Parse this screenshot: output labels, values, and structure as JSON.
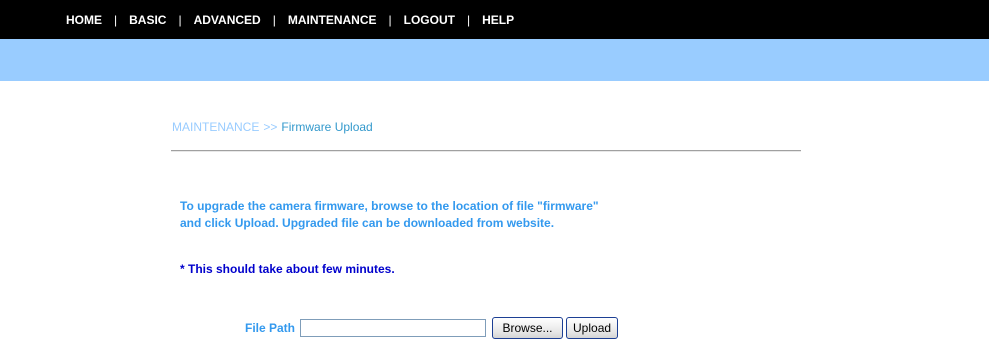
{
  "nav": {
    "items": [
      "HOME",
      "BASIC",
      "ADVANCED",
      "MAINTENANCE",
      "LOGOUT",
      "HELP"
    ],
    "separator": "|"
  },
  "breadcrumb": {
    "section": "MAINTENANCE",
    "arrow": ">>",
    "page": "Firmware Upload"
  },
  "main": {
    "description_line1": "To upgrade the camera firmware, browse to the location of file \"firmware\"",
    "description_line2": "and click Upload. Upgraded file can be downloaded from website.",
    "note": "* This should take about few minutes."
  },
  "form": {
    "file_path_label": "File Path",
    "file_path_value": "",
    "browse_label": "Browse...",
    "upload_label": "Upload"
  },
  "colors": {
    "topbar": "#000000",
    "subbar": "#99ccff",
    "description_text": "#3399ee",
    "note_text": "#0000cc"
  }
}
